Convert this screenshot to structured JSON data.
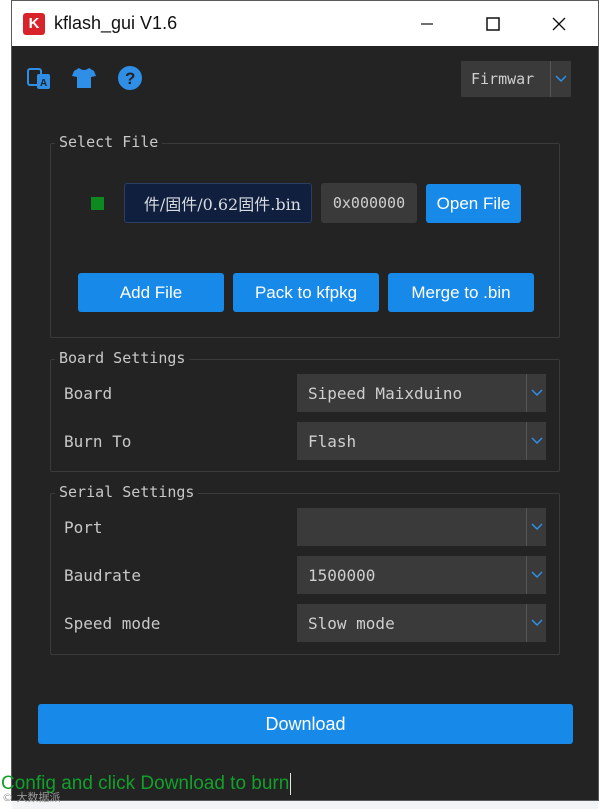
{
  "window": {
    "title": "kflash_gui V1.6",
    "logo_letter": "K"
  },
  "toolbar": {
    "language_icon": "translate-icon",
    "skin_icon": "tshirt-icon",
    "help_icon": "help-icon",
    "mode_select": {
      "value": "Firmwar"
    }
  },
  "select_file": {
    "title": "Select File",
    "file_path": "件/固件/0.62固件.bin",
    "address": "0x000000",
    "open_file_label": "Open File",
    "add_file_label": "Add File",
    "pack_label": "Pack to kfpkg",
    "merge_label": "Merge to .bin"
  },
  "board_settings": {
    "title": "Board Settings",
    "board_label": "Board",
    "board_value": "Sipeed Maixduino",
    "burn_to_label": "Burn To",
    "burn_to_value": "Flash"
  },
  "serial_settings": {
    "title": "Serial Settings",
    "port_label": "Port",
    "port_value": "",
    "baudrate_label": "Baudrate",
    "baudrate_value": "1500000",
    "speed_mode_label": "Speed mode",
    "speed_mode_value": "Slow mode"
  },
  "download_label": "Download",
  "status": "Config and click Download to burn",
  "watermark": "© 大数据派",
  "colors": {
    "accent": "#1789e8",
    "status_green": "#11a12a",
    "indicator": "#0d8a1f",
    "panel_bg": "#232323"
  }
}
